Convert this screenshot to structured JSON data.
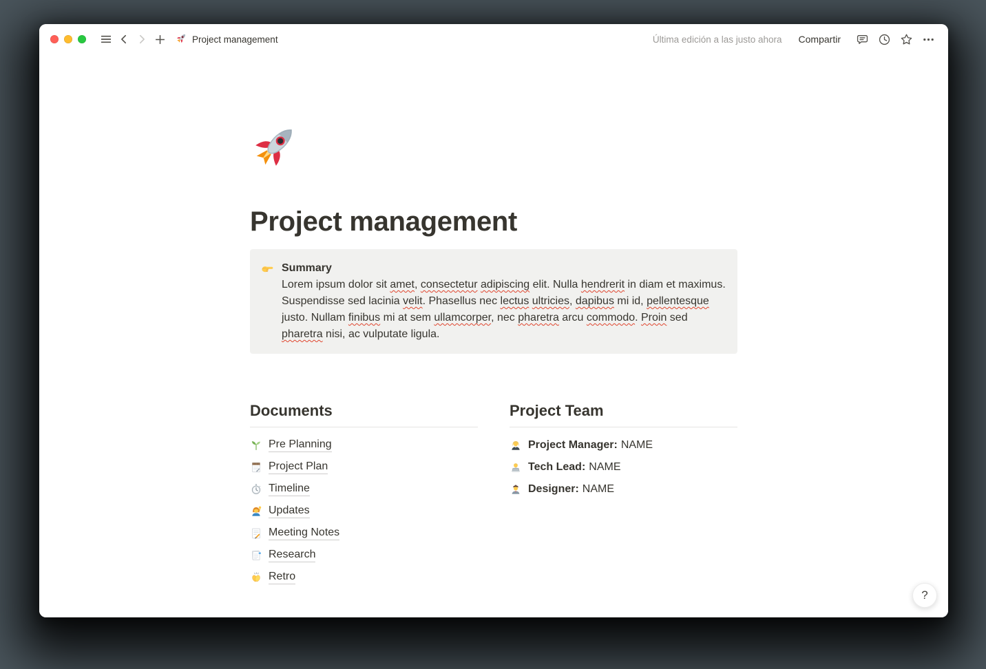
{
  "titlebar": {
    "title": "Project management",
    "page_icon": "rocket-emoji",
    "edited_label": "Última edición a las justo ahora",
    "share_label": "Compartir",
    "icons": [
      "sidebar-menu",
      "nav-back",
      "nav-forward",
      "new-page-plus",
      "comments",
      "updates-clock",
      "favorite-star",
      "more-ellipsis"
    ]
  },
  "page": {
    "icon": "rocket-emoji",
    "title": "Project management"
  },
  "callout": {
    "icon": "pointing-right-emoji",
    "heading": "Summary",
    "body": "Lorem ipsum dolor sit amet, consectetur adipiscing elit. Nulla hendrerit in diam et maximus. Suspendisse sed lacinia velit. Phasellus nec lectus ultricies, dapibus mi id, pellentesque justo. Nullam finibus mi at sem ullamcorper, nec pharetra arcu commodo. Proin sed pharetra nisi, ac vulputate ligula.",
    "misspelled_words": [
      "amet",
      "consectetur",
      "adipiscing",
      "hendrerit",
      "velit",
      "lectus",
      "ultricies",
      "dapibus",
      "pellentesque",
      "finibus",
      "ullamcorper",
      "pharetra",
      "commodo",
      "Proin"
    ]
  },
  "documents": {
    "heading": "Documents",
    "items": [
      {
        "icon": "seedling-emoji",
        "label": "Pre Planning"
      },
      {
        "icon": "spiral-notepad-emoji",
        "label": "Project Plan"
      },
      {
        "icon": "stopwatch-emoji",
        "label": "Timeline"
      },
      {
        "icon": "woman-raising-hand-emoji",
        "label": "Updates"
      },
      {
        "icon": "memo-emoji",
        "label": "Meeting Notes"
      },
      {
        "icon": "bookmark-tabs-emoji",
        "label": "Research"
      },
      {
        "icon": "clapping-hands-emoji",
        "label": "Retro"
      }
    ]
  },
  "team": {
    "heading": "Project Team",
    "members": [
      {
        "icon": "woman-office-worker-emoji",
        "role": "Project Manager:",
        "name": "NAME"
      },
      {
        "icon": "technologist-emoji",
        "role": "Tech Lead:",
        "name": "NAME"
      },
      {
        "icon": "man-artist-emoji",
        "role": "Designer:",
        "name": "NAME"
      }
    ]
  },
  "help": {
    "label": "?"
  },
  "colors": {
    "text": "#37352F",
    "muted_text": "#9C9A97",
    "callout_bg": "#F1F1EF",
    "divider": "#E5E4E2",
    "spellcheck": "#E0442C",
    "desktop_bg": "#4A555C",
    "traffic_red": "#FF5F57",
    "traffic_yellow": "#FEBC2E",
    "traffic_green": "#28C840"
  }
}
